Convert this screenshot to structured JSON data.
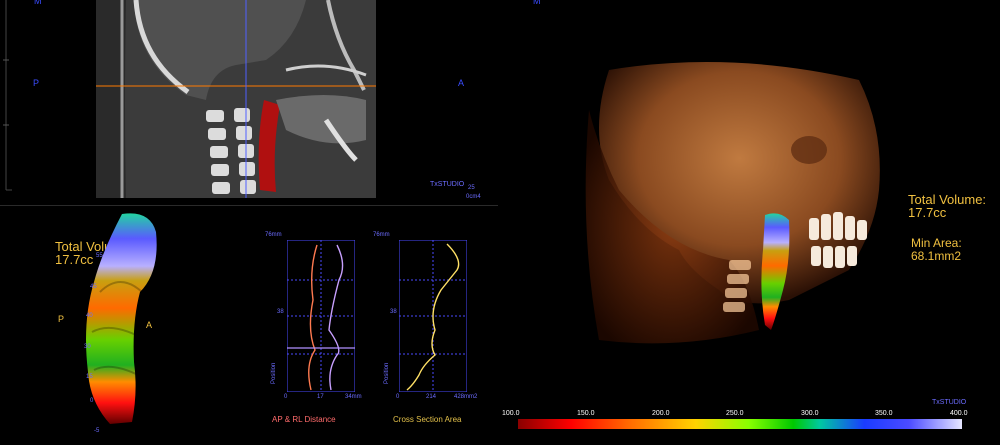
{
  "top_left_pane": {
    "orientation_top": "M",
    "orientation_left": "P",
    "orientation_right": "A",
    "watermark": "TxSTUDIO",
    "scale_top": "25",
    "scale_bottom": "0cm4"
  },
  "right_pane": {
    "orientation_top": "M",
    "total_volume_label": "Total Volume:",
    "total_volume_value": "17.7cc",
    "min_area_label": "Min Area:",
    "min_area_value": "68.1mm2",
    "watermark": "TxSTUDIO",
    "colorbar_ticks": [
      "100.0",
      "150.0",
      "200.0",
      "250.0",
      "300.0",
      "350.0",
      "400.0"
    ]
  },
  "bottom_left_pane": {
    "total_volume_label": "Total Volume:",
    "total_volume_value": "17.7cc",
    "left_orientation": "P",
    "right_orientation": "A",
    "airway_ticks": [
      "55",
      "45",
      "40",
      "30",
      "15",
      "0",
      "-5"
    ]
  },
  "graphs": {
    "ap_rl": {
      "ymax": "76mm",
      "ymid": "38",
      "ylabel": "Position",
      "xticks": [
        "0",
        "17",
        "34mm"
      ],
      "title_prefix": "AP",
      "title_suffix": " & RL Distance"
    },
    "area": {
      "ymax": "76mm",
      "ymid": "38",
      "ylabel": "Position",
      "xticks": [
        "0",
        "214",
        "428mm2"
      ],
      "title": "Cross Section Area"
    }
  }
}
